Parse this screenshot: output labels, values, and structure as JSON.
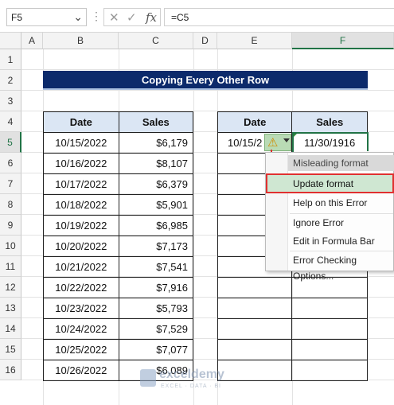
{
  "formula_bar": {
    "name_box": "F5",
    "dropdown_glyph": "⌄",
    "dots_glyph": "⋮",
    "cancel_glyph": "✕",
    "enter_glyph": "✓",
    "fx_label": "fx",
    "formula": "=C5"
  },
  "columns": [
    "A",
    "B",
    "C",
    "D",
    "E",
    "F"
  ],
  "selected_column": "F",
  "rows": [
    "1",
    "2",
    "3",
    "4",
    "5",
    "6",
    "7",
    "8",
    "9",
    "10",
    "11",
    "12",
    "13",
    "14",
    "15",
    "16"
  ],
  "selected_row": "5",
  "title": "Copying Every Other Row",
  "left_table": {
    "headers": [
      "Date",
      "Sales"
    ],
    "rows": [
      [
        "10/15/2022",
        "$6,179"
      ],
      [
        "10/16/2022",
        "$8,107"
      ],
      [
        "10/17/2022",
        "$6,379"
      ],
      [
        "10/18/2022",
        "$5,901"
      ],
      [
        "10/19/2022",
        "$6,985"
      ],
      [
        "10/20/2022",
        "$7,173"
      ],
      [
        "10/21/2022",
        "$7,541"
      ],
      [
        "10/22/2022",
        "$7,916"
      ],
      [
        "10/23/2022",
        "$5,793"
      ],
      [
        "10/24/2022",
        "$7,529"
      ],
      [
        "10/25/2022",
        "$7,077"
      ],
      [
        "10/26/2022",
        "$6,089"
      ]
    ]
  },
  "right_table": {
    "headers": [
      "Date",
      "Sales"
    ],
    "first_date": "10/15/2",
    "first_sales": "11/30/1916"
  },
  "error_menu": {
    "header": "Misleading format",
    "items": [
      "Update format",
      "Help on this Error",
      "Ignore Error",
      "Edit in Formula Bar",
      "Error Checking Options..."
    ],
    "highlighted": "Update format"
  },
  "watermark": {
    "name": "exceldemy",
    "tagline": "EXCEL · DATA · BI"
  },
  "colors": {
    "banner": "#0c2a6b",
    "header_fill": "#dbe6f4",
    "excel_green": "#217346",
    "highlight_red": "#e03030"
  },
  "icons": [
    "dropdown-icon",
    "cancel-icon",
    "enter-icon",
    "function-icon",
    "warning-icon",
    "arrow-down-icon"
  ]
}
